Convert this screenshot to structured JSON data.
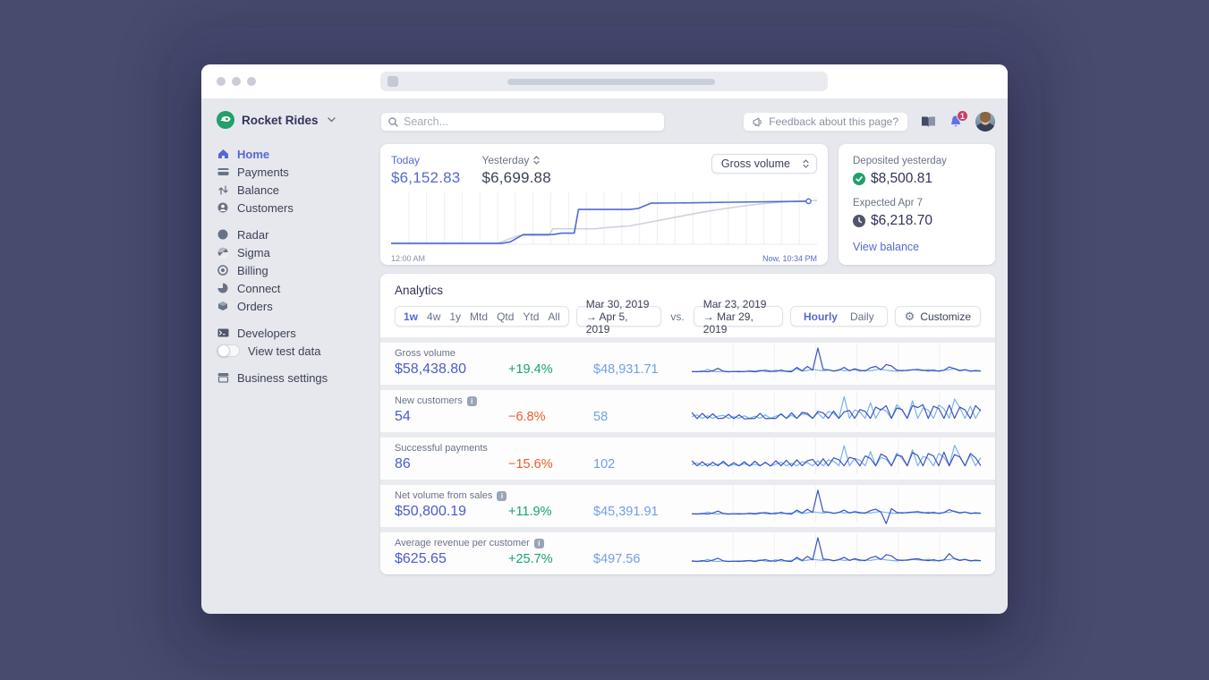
{
  "colors": {
    "accent_blue": "#5469d4",
    "value_indigo": "#4b5bce",
    "previous_blue": "#6ea0e8",
    "positive_green": "#17a273",
    "negative_orange": "#ea5b2d",
    "spark_current": "#3b4fc0",
    "spark_previous": "#74b3ec",
    "yesterday_gray": "#cdd2dd",
    "logo_green": "#21a06b"
  },
  "sidebar": {
    "account": {
      "name": "Rocket Rides"
    },
    "sections": [
      {
        "items": [
          {
            "label": "Home",
            "active": true
          },
          {
            "label": "Payments"
          },
          {
            "label": "Balance"
          },
          {
            "label": "Customers"
          }
        ]
      },
      {
        "items": [
          {
            "label": "Radar"
          },
          {
            "label": "Sigma"
          },
          {
            "label": "Billing"
          },
          {
            "label": "Connect"
          },
          {
            "label": "Orders"
          }
        ]
      },
      {
        "items": [
          {
            "label": "Developers"
          },
          {
            "label": "View test data",
            "toggle": "off"
          }
        ]
      },
      {
        "items": [
          {
            "label": "Business settings"
          }
        ]
      }
    ]
  },
  "topbar": {
    "search_placeholder": "Search...",
    "feedback_label": "Feedback about this page?",
    "notification_count": "1"
  },
  "overview": {
    "today_label": "Today",
    "today_value": "$6,152.83",
    "yesterday_label": "Yesterday",
    "yesterday_value": "$6,699.88",
    "metric_select": "Gross volume",
    "x_start": "12:00 AM",
    "x_end": "Now, 10:34 PM"
  },
  "deposits": {
    "deposited_label": "Deposited yesterday",
    "deposited_value": "$8,500.81",
    "expected_label": "Expected Apr 7",
    "expected_value": "$6,218.70",
    "link": "View balance"
  },
  "analytics": {
    "title": "Analytics",
    "ranges": [
      "1w",
      "4w",
      "1y",
      "Mtd",
      "Qtd",
      "Ytd",
      "All"
    ],
    "active_range": "1w",
    "period_current": "Mar 30, 2019 → Apr 5, 2019",
    "vs_label": "vs.",
    "period_previous": "Mar 23, 2019 → Mar 29, 2019",
    "granularities": [
      "Hourly",
      "Daily"
    ],
    "active_granularity": "Hourly",
    "customize_label": "Customize",
    "metrics": [
      {
        "label": "Gross volume",
        "value": "$58,438.80",
        "delta": "+19.4%",
        "previous": "$48,931.71",
        "info": false
      },
      {
        "label": "New customers",
        "value": "54",
        "delta": "−6.8%",
        "previous": "58",
        "info": true
      },
      {
        "label": "Successful payments",
        "value": "86",
        "delta": "−15.6%",
        "previous": "102",
        "info": false
      },
      {
        "label": "Net volume from sales",
        "value": "$50,800.19",
        "delta": "+11.9%",
        "previous": "$45,391.91",
        "info": true
      },
      {
        "label": "Average revenue per customer",
        "value": "$625.65",
        "delta": "+25.7%",
        "previous": "$497.56",
        "info": true
      }
    ]
  },
  "chart_data": [
    {
      "id": "overview",
      "type": "line",
      "title": "Gross volume, today vs yesterday (cumulative)",
      "x_axis": "Time of day, 12:00 AM to now (10:34 PM)",
      "gridline_segments": 24,
      "series": [
        {
          "name": "Yesterday",
          "total": 6699.88,
          "points": [
            [
              0,
              2
            ],
            [
              25,
              2
            ],
            [
              30,
              18
            ],
            [
              37,
              18
            ],
            [
              38,
              32
            ],
            [
              48,
              32
            ],
            [
              50,
              34
            ],
            [
              56,
              38
            ],
            [
              62,
              48
            ],
            [
              68,
              58
            ],
            [
              74,
              68
            ],
            [
              80,
              76
            ],
            [
              86,
              83
            ],
            [
              93,
              88
            ],
            [
              100,
              91
            ]
          ]
        },
        {
          "name": "Today",
          "total": 6152.83,
          "endpoint_marker": true,
          "points": [
            [
              0,
              2
            ],
            [
              26,
              2
            ],
            [
              28,
              5
            ],
            [
              31,
              20
            ],
            [
              38,
              20
            ],
            [
              40,
              23
            ],
            [
              43,
              23
            ],
            [
              44,
              72
            ],
            [
              56,
              72
            ],
            [
              58,
              74
            ],
            [
              61,
              85
            ],
            [
              72,
              86
            ],
            [
              80,
              87
            ],
            [
              98,
              89
            ]
          ]
        }
      ]
    },
    {
      "id": "spark-gross-volume",
      "type": "line",
      "title": "Gross volume hourly, 1w",
      "gridline_segments": 7,
      "series": [
        {
          "name": "previous",
          "values": [
            2,
            3,
            2,
            12,
            3,
            2,
            4,
            2,
            3,
            4,
            2,
            6,
            4,
            8,
            3,
            2,
            9,
            3,
            5,
            6,
            14,
            4,
            7,
            12,
            8,
            6,
            9,
            4,
            11,
            6,
            8,
            10,
            4,
            8,
            6,
            10,
            13,
            8,
            6,
            4,
            8,
            6,
            10,
            8,
            6,
            11,
            4,
            6,
            8,
            10,
            16,
            8,
            11,
            6,
            4,
            5
          ]
        },
        {
          "name": "current",
          "values": [
            3,
            2,
            4,
            2,
            6,
            16,
            4,
            2,
            3,
            2,
            3,
            4,
            2,
            5,
            8,
            4,
            3,
            9,
            3,
            2,
            20,
            6,
            24,
            8,
            100,
            12,
            10,
            5,
            8,
            20,
            6,
            14,
            8,
            5,
            18,
            24,
            10,
            32,
            26,
            9,
            6,
            8,
            10,
            12,
            8,
            5,
            9,
            4,
            8,
            22,
            14,
            6,
            10,
            4,
            7,
            5
          ]
        }
      ]
    },
    {
      "id": "spark-new-customers",
      "type": "line",
      "title": "New customers hourly, 1w",
      "gridline_segments": 7,
      "series": [
        {
          "name": "previous",
          "values": [
            12,
            20,
            5,
            16,
            5,
            14,
            18,
            5,
            12,
            5,
            16,
            5,
            14,
            5,
            20,
            5,
            14,
            22,
            5,
            18,
            5,
            24,
            20,
            5,
            28,
            5,
            34,
            26,
            5,
            95,
            5,
            40,
            32,
            5,
            70,
            5,
            45,
            36,
            5,
            62,
            40,
            5,
            78,
            5,
            48,
            40,
            5,
            60,
            45,
            5,
            85,
            50,
            5,
            55,
            5,
            45
          ]
        },
        {
          "name": "current",
          "values": [
            30,
            4,
            26,
            5,
            24,
            4,
            6,
            22,
            4,
            20,
            3,
            4,
            5,
            26,
            4,
            5,
            5,
            24,
            5,
            28,
            5,
            30,
            26,
            5,
            34,
            28,
            5,
            36,
            5,
            32,
            38,
            5,
            42,
            34,
            5,
            52,
            40,
            58,
            5,
            48,
            42,
            5,
            58,
            50,
            62,
            5,
            55,
            46,
            5,
            60,
            5,
            52,
            40,
            5,
            58,
            36
          ]
        }
      ]
    },
    {
      "id": "spark-successful-payments",
      "type": "line",
      "title": "Successful payments hourly, 1w",
      "gridline_segments": 7,
      "series": [
        {
          "name": "previous",
          "values": [
            10,
            18,
            5,
            14,
            5,
            12,
            16,
            5,
            10,
            5,
            14,
            5,
            12,
            5,
            18,
            5,
            12,
            20,
            5,
            16,
            5,
            22,
            18,
            5,
            26,
            5,
            30,
            24,
            5,
            88,
            5,
            36,
            28,
            5,
            64,
            5,
            40,
            32,
            5,
            58,
            36,
            5,
            72,
            5,
            44,
            36,
            5,
            56,
            40,
            5,
            90,
            46,
            5,
            50,
            5,
            40
          ]
        },
        {
          "name": "current",
          "values": [
            26,
            5,
            22,
            4,
            20,
            5,
            24,
            4,
            18,
            5,
            22,
            4,
            24,
            5,
            20,
            4,
            26,
            5,
            28,
            4,
            30,
            5,
            26,
            32,
            5,
            34,
            5,
            38,
            30,
            5,
            40,
            34,
            5,
            46,
            36,
            5,
            54,
            42,
            5,
            50,
            44,
            5,
            60,
            48,
            5,
            56,
            46,
            5,
            62,
            5,
            52,
            42,
            5,
            56,
            38,
            5
          ]
        }
      ]
    },
    {
      "id": "spark-net-volume",
      "type": "line",
      "title": "Net volume from sales hourly, 1w",
      "gridline_segments": 7,
      "series": [
        {
          "name": "previous",
          "values": [
            2,
            3,
            2,
            10,
            3,
            2,
            4,
            2,
            3,
            4,
            2,
            6,
            4,
            8,
            3,
            2,
            8,
            3,
            5,
            6,
            12,
            4,
            7,
            11,
            8,
            6,
            9,
            4,
            10,
            6,
            8,
            9,
            4,
            8,
            6,
            10,
            12,
            8,
            6,
            4,
            8,
            6,
            9,
            8,
            6,
            10,
            4,
            6,
            8,
            9,
            14,
            8,
            10,
            6,
            4,
            5
          ]
        },
        {
          "name": "current",
          "values": [
            3,
            2,
            4,
            2,
            6,
            14,
            4,
            2,
            3,
            2,
            3,
            4,
            2,
            5,
            8,
            4,
            3,
            9,
            3,
            2,
            18,
            6,
            22,
            8,
            100,
            12,
            10,
            5,
            8,
            18,
            6,
            12,
            8,
            5,
            16,
            22,
            10,
            -38,
            24,
            9,
            6,
            8,
            10,
            12,
            8,
            5,
            9,
            4,
            8,
            20,
            12,
            6,
            10,
            4,
            7,
            5
          ]
        }
      ]
    },
    {
      "id": "spark-average-revenue",
      "type": "line",
      "title": "Average revenue per customer hourly, 1w",
      "gridline_segments": 7,
      "series": [
        {
          "name": "previous",
          "values": [
            2,
            3,
            2,
            11,
            3,
            2,
            4,
            2,
            3,
            4,
            2,
            6,
            4,
            8,
            3,
            2,
            9,
            3,
            5,
            6,
            13,
            4,
            7,
            11,
            8,
            6,
            9,
            4,
            10,
            6,
            8,
            10,
            4,
            8,
            6,
            10,
            12,
            8,
            6,
            4,
            8,
            6,
            10,
            8,
            6,
            11,
            4,
            6,
            8,
            10,
            15,
            8,
            11,
            6,
            4,
            5
          ]
        },
        {
          "name": "current",
          "values": [
            4,
            2,
            5,
            2,
            7,
            15,
            4,
            2,
            3,
            2,
            4,
            5,
            2,
            6,
            9,
            4,
            3,
            10,
            3,
            2,
            19,
            6,
            23,
            8,
            100,
            12,
            10,
            5,
            9,
            19,
            6,
            13,
            8,
            5,
            17,
            23,
            10,
            30,
            25,
            9,
            6,
            8,
            11,
            13,
            8,
            5,
            9,
            4,
            8,
            34,
            13,
            6,
            10,
            4,
            7,
            5
          ]
        }
      ]
    }
  ]
}
